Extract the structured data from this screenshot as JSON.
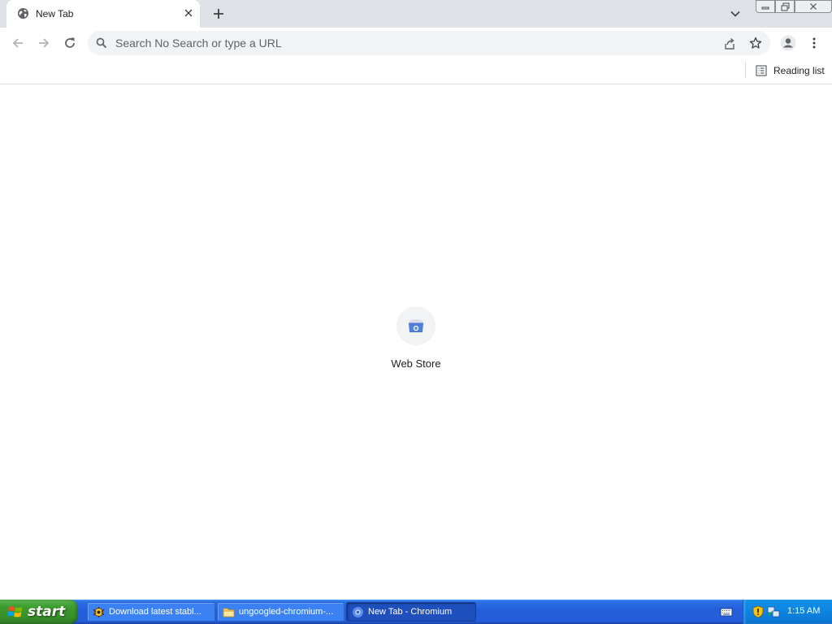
{
  "tabs": [
    {
      "title": "New Tab",
      "icon": "globe-icon",
      "active": true
    }
  ],
  "window_controls": {
    "minimize": "minimize-icon",
    "restore": "restore-icon",
    "close": "close-icon"
  },
  "toolbar": {
    "back_icon": "back-arrow-icon",
    "forward_icon": "forward-arrow-icon",
    "reload_icon": "reload-icon"
  },
  "omnibox": {
    "placeholder": "Search No Search or type a URL",
    "value": ""
  },
  "bookmarks_bar": {
    "reading_list_label": "Reading list"
  },
  "ntp": {
    "shortcuts": [
      {
        "label": "Web Store",
        "icon": "web-store-icon"
      }
    ]
  },
  "taskbar": {
    "start_label": "start",
    "tasks": [
      {
        "label": "Download latest stabl...",
        "icon": "download-tool-icon",
        "active": false
      },
      {
        "label": "ungoogled-chromium-...",
        "icon": "folder-icon",
        "active": false
      },
      {
        "label": "New Tab - Chromium",
        "icon": "chromium-icon",
        "active": true
      }
    ],
    "clock": "1:15 AM"
  },
  "colors": {
    "tab_strip": "#dee1e6",
    "omnibox_bg": "#f1f3f4",
    "taskbar_blue": "#245edb",
    "start_green": "#3c9c2e",
    "tray_blue": "#0e8ae6"
  }
}
